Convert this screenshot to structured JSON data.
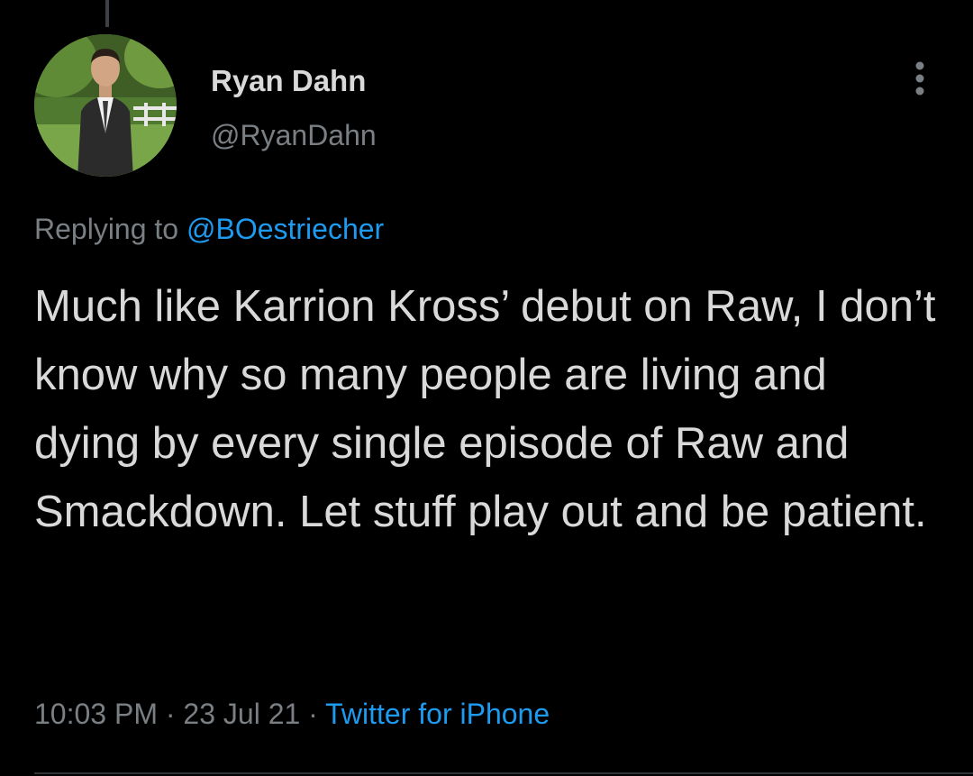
{
  "author": {
    "display_name": "Ryan Dahn",
    "handle": "@RyanDahn",
    "avatar_icon": "profile-photo-icon"
  },
  "reply": {
    "prefix": "Replying to",
    "mention": "@BOestriecher"
  },
  "tweet": {
    "text": "Much like Karrion Kross’ debut on Raw, I don’t know why so many people are living and dying by every single episode of Raw and Smackdown. Let stuff play out and be patient."
  },
  "meta": {
    "time": "10:03 PM",
    "date": "23 Jul 21",
    "separator": "·",
    "source": "Twitter for iPhone"
  },
  "icons": {
    "more": "more-vertical-icon"
  },
  "colors": {
    "background": "#000000",
    "text": "#d9d9d9",
    "secondary_text": "#7a7f84",
    "link": "#1d9bf0"
  }
}
